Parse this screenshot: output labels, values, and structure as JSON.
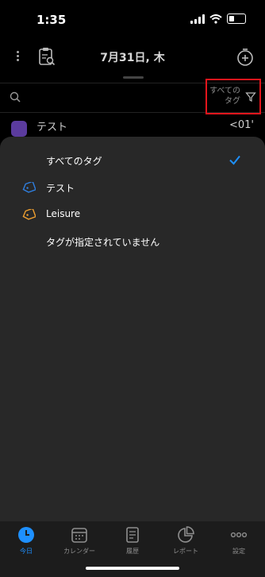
{
  "status": {
    "time": "1:35"
  },
  "header": {
    "title": "7月31日, 木"
  },
  "filter": {
    "label_line1": "すべての",
    "label_line2": "タグ"
  },
  "entry": {
    "name": "テスト",
    "time": "<01'"
  },
  "tag_options": [
    {
      "label": "すべてのタグ",
      "selected": true
    },
    {
      "label": "テスト",
      "tag_color": "#2f7fe0"
    },
    {
      "label": "Leisure",
      "tag_color": "#f0a030"
    },
    {
      "label": "タグが指定されていません"
    }
  ],
  "tabs": [
    {
      "label": "今日",
      "active": true
    },
    {
      "label": "カレンダー"
    },
    {
      "label": "履歴"
    },
    {
      "label": "レポート"
    },
    {
      "label": "設定"
    }
  ],
  "colors": {
    "accent": "#1e90ff",
    "highlight_box": "#e3151c"
  }
}
